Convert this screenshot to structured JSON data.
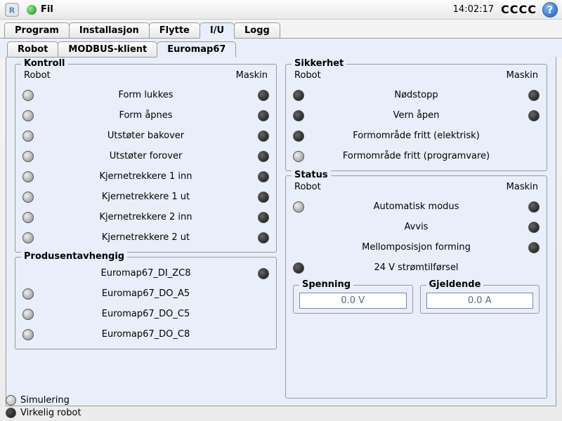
{
  "topbar": {
    "fil": "Fil",
    "clock": "14:02:17",
    "cccc": "CCCC"
  },
  "tabs": {
    "program": "Program",
    "installasjon": "Installasjon",
    "flytte": "Flytte",
    "iu": "I/U",
    "logg": "Logg"
  },
  "subtabs": {
    "robot": "Robot",
    "modbus": "MODBUS-klient",
    "euromap": "Euromap67"
  },
  "hdr": {
    "robot": "Robot",
    "maskin": "Maskin"
  },
  "kontroll": {
    "title": "Kontroll",
    "rows": [
      {
        "label": "Form lukkes",
        "l": "light",
        "r": "dark"
      },
      {
        "label": "Form åpnes",
        "l": "light",
        "r": "dark"
      },
      {
        "label": "Utstøter bakover",
        "l": "light",
        "r": "dark"
      },
      {
        "label": "Utstøter forover",
        "l": "light",
        "r": "dark"
      },
      {
        "label": "Kjernetrekkere 1 inn",
        "l": "light",
        "r": "dark"
      },
      {
        "label": "Kjernetrekkere 1 ut",
        "l": "light",
        "r": "dark"
      },
      {
        "label": "Kjernetrekkere 2 inn",
        "l": "light",
        "r": "dark"
      },
      {
        "label": "Kjernetrekkere 2 ut",
        "l": "light",
        "r": "dark"
      }
    ]
  },
  "produsent": {
    "title": "Produsentavhengig",
    "rows": [
      {
        "label": "Euromap67_DI_ZC8",
        "l": "none",
        "r": "dark"
      },
      {
        "label": "Euromap67_DO_A5",
        "l": "light",
        "r": "none"
      },
      {
        "label": "Euromap67_DO_C5",
        "l": "light",
        "r": "none"
      },
      {
        "label": "Euromap67_DO_C8",
        "l": "light",
        "r": "none"
      }
    ]
  },
  "sikkerhet": {
    "title": "Sikkerhet",
    "rows": [
      {
        "label": "Nødstopp",
        "l": "dark",
        "r": "dark"
      },
      {
        "label": "Vern åpen",
        "l": "dark",
        "r": "dark"
      },
      {
        "label": "Formområde fritt (elektrisk)",
        "l": "dark",
        "r": "none"
      },
      {
        "label": "Formområde fritt (programvare)",
        "l": "light",
        "r": "none"
      }
    ]
  },
  "status": {
    "title": "Status",
    "rows": [
      {
        "label": "Automatisk modus",
        "l": "light",
        "r": "dark"
      },
      {
        "label": "Avvis",
        "l": "none",
        "r": "dark"
      },
      {
        "label": "Mellomposisjon forming",
        "l": "none",
        "r": "dark"
      },
      {
        "label": "24 V strømtilførsel",
        "l": "dark",
        "r": "none"
      }
    ]
  },
  "spenning": {
    "title": "Spenning",
    "value": "0.0 V"
  },
  "gjeldende": {
    "title": "Gjeldende",
    "value": "0.0 A"
  },
  "footer": {
    "sim": "Simulering",
    "real": "Virkelig robot"
  }
}
